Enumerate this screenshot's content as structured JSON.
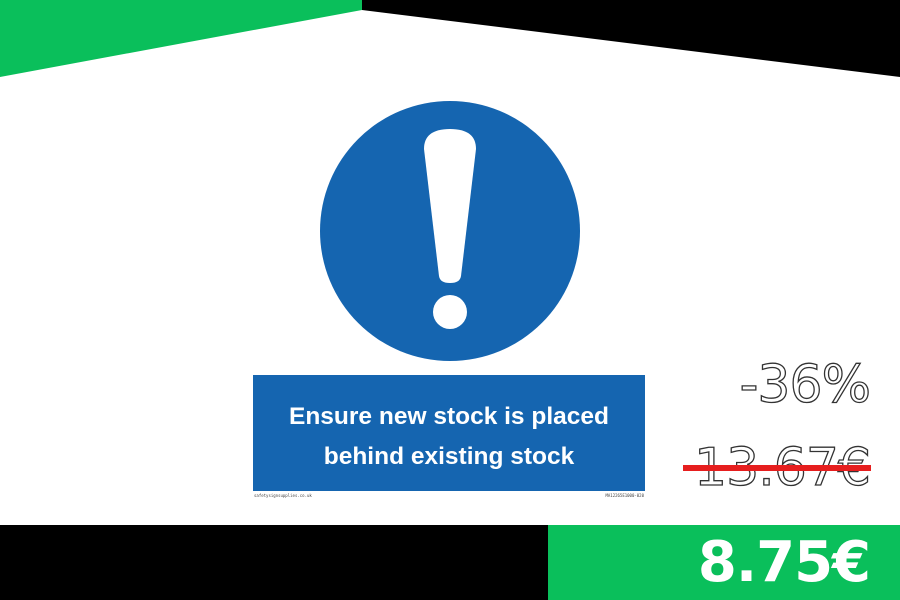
{
  "colors": {
    "accent_green": "#0abf5b",
    "sign_blue": "#1565b0",
    "strike_red": "#e61e1e",
    "black": "#000000"
  },
  "sign": {
    "icon": "exclamation-mark-icon",
    "text_line1": "Ensure new stock is placed",
    "text_line2": "behind existing stock",
    "footer_left": "safetysignsupplies.co.uk",
    "footer_right": "MA12265E1000-020"
  },
  "pricing": {
    "discount": "-36%",
    "old_price": "13.67€",
    "new_price": "8.75€"
  }
}
